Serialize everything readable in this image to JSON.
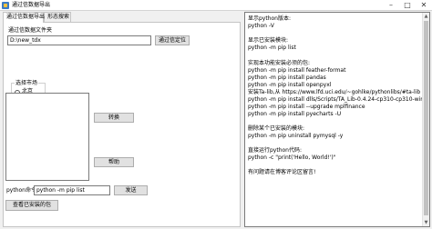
{
  "window": {
    "title": "通过信数据导出",
    "controls": [
      "–",
      "□",
      "✕"
    ]
  },
  "tabs": [
    {
      "label": "通过信数据导出",
      "active": true
    },
    {
      "label": "形态搜索",
      "active": false
    }
  ],
  "folder": {
    "label": "通过信数据文件夹",
    "path": "D:\\new_tdx",
    "locate_button": "通过信定位"
  },
  "market": {
    "group_title": "选择市场",
    "options": [
      "北京",
      "上海",
      "深圳"
    ]
  },
  "buttons": {
    "convert": "转换",
    "help": "帮助",
    "send": "发送",
    "view_installed": "查看已安装的包"
  },
  "command": {
    "label": "python命令:",
    "value": "python -m pip list"
  },
  "output": {
    "lines": [
      "显示python版本:",
      "python -V",
      "",
      "显示已安装模块:",
      "python -m pip list",
      "",
      "实现本功能安装必须的包:",
      "python -m pip install feather-format",
      "python -m pip install pandas",
      "python -m pip install openpyxl",
      "安装Ta-lib,从 https://www.lfd.uci.edu/~gohlke/pythonlibs/#ta-lib 下载",
      "python -m pip install dlls/Scripts/TA_Lib-0.4.24-cp310-cp310-win_amd",
      "python -m pip install --upgrade mplfinance",
      "python -m pip install pyecharts -U",
      "",
      "删除某个已安装的模块:",
      "python -m pip uninstall pymysql -y",
      "",
      "直接运行python代码:",
      "python -c \"print('Hello, World!')\"",
      "",
      "有问题请在博客评论区留言!"
    ]
  }
}
